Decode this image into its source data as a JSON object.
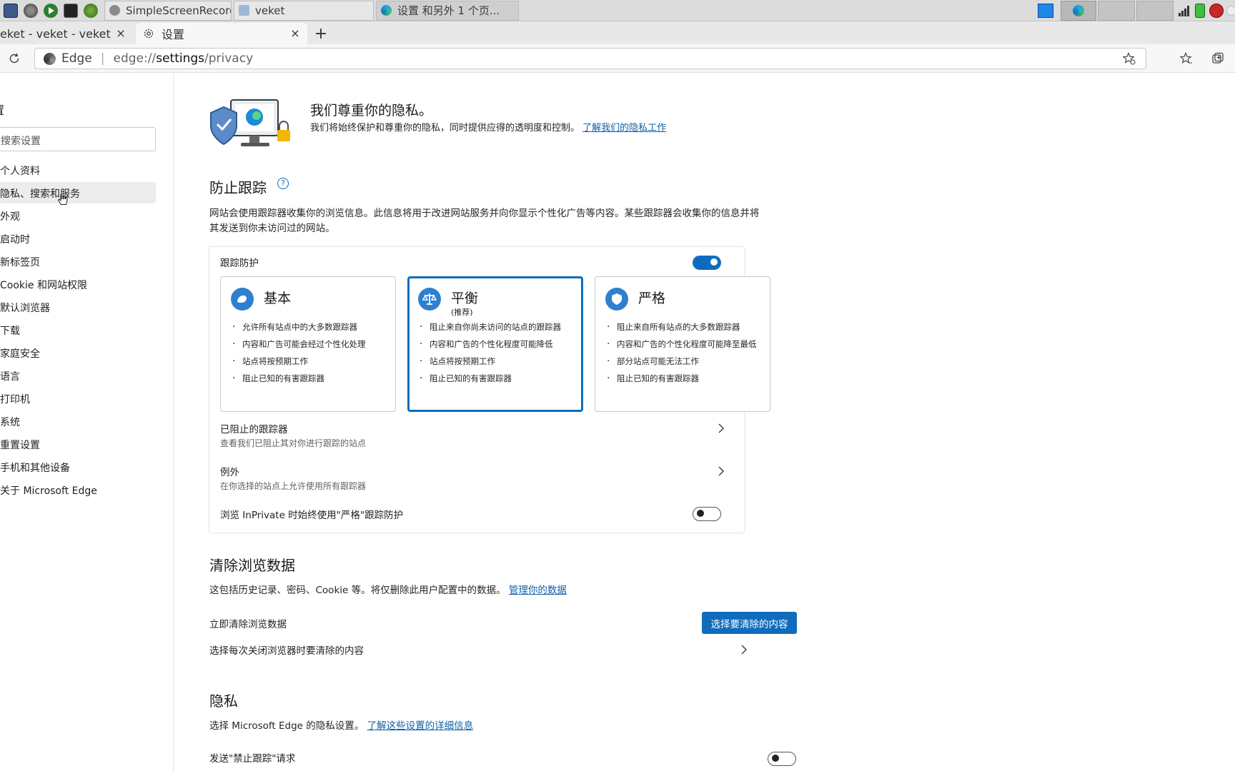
{
  "taskbar": {
    "tasks": [
      {
        "label": "SimpleScreenRecorder"
      },
      {
        "label": "veket"
      },
      {
        "label": "设置 和另外 1 个页..."
      }
    ]
  },
  "browser": {
    "tabs": [
      {
        "title": "eket - veket - veket",
        "close": "×"
      },
      {
        "title": "设置",
        "close": "×"
      }
    ],
    "new_tab": "+",
    "address": {
      "brand": "Edge",
      "prefix": "edge://",
      "host": "settings",
      "path": "/privacy"
    }
  },
  "sidebar": {
    "title": "置",
    "search_placeholder": "搜索设置",
    "items": [
      {
        "label": "个人资料"
      },
      {
        "label": "隐私、搜索和服务"
      },
      {
        "label": "外观"
      },
      {
        "label": "启动时"
      },
      {
        "label": "新标签页"
      },
      {
        "label": "Cookie 和网站权限"
      },
      {
        "label": "默认浏览器"
      },
      {
        "label": "下载"
      },
      {
        "label": "家庭安全"
      },
      {
        "label": "语言"
      },
      {
        "label": "打印机"
      },
      {
        "label": "系统"
      },
      {
        "label": "重置设置"
      },
      {
        "label": "手机和其他设备"
      },
      {
        "label": "关于 Microsoft Edge"
      }
    ]
  },
  "hero": {
    "title": "我们尊重你的隐私。",
    "text": "我们将始终保护和尊重你的隐私，同时提供应得的透明度和控制。",
    "link": "了解我们的隐私工作"
  },
  "tracking": {
    "title": "防止跟踪",
    "help": "?",
    "desc": "网站会使用跟踪器收集你的浏览信息。此信息将用于改进网站服务并向你显示个性化广告等内容。某些跟踪器会收集你的信息并将其发送到你未访问过的网站。",
    "card_title": "跟踪防护",
    "enabled": true,
    "modes": [
      {
        "title": "基本",
        "subtitle": "",
        "bullets": [
          "允许所有站点中的大多数跟踪器",
          "内容和广告可能会经过个性化处理",
          "站点将按预期工作",
          "阻止已知的有害跟踪器"
        ]
      },
      {
        "title": "平衡",
        "subtitle": "(推荐)",
        "bullets": [
          "阻止来自你尚未访问的站点的跟踪器",
          "内容和广告的个性化程度可能降低",
          "站点将按预期工作",
          "阻止已知的有害跟踪器"
        ]
      },
      {
        "title": "严格",
        "subtitle": "",
        "bullets": [
          "阻止来自所有站点的大多数跟踪器",
          "内容和广告的个性化程度可能降至最低",
          "部分站点可能无法工作",
          "阻止已知的有害跟踪器"
        ]
      }
    ],
    "selected_mode": "平衡",
    "blocked": {
      "title": "已阻止的跟踪器",
      "subtitle": "查看我们已阻止其对你进行跟踪的站点"
    },
    "exceptions": {
      "title": "例外",
      "subtitle": "在你选择的站点上允许使用所有跟踪器"
    },
    "inprivate": {
      "label": "浏览 InPrivate 时始终使用\"严格\"跟踪防护",
      "enabled": false
    }
  },
  "clear": {
    "title": "清除浏览数据",
    "desc": "这包括历史记录、密码、Cookie 等。将仅删除此用户配置中的数据。",
    "link": "管理你的数据",
    "now_label": "立即清除浏览数据",
    "button": "选择要清除的内容",
    "on_close": "选择每次关闭浏览器时要清除的内容"
  },
  "privacy": {
    "title": "隐私",
    "desc": "选择 Microsoft Edge 的隐私设置。",
    "link": "了解这些设置的详细信息",
    "dnt_label": "发送\"禁止跟踪\"请求",
    "dnt_enabled": false
  },
  "colors": {
    "accent": "#0f6cbd",
    "link": "#0f5fa8"
  }
}
